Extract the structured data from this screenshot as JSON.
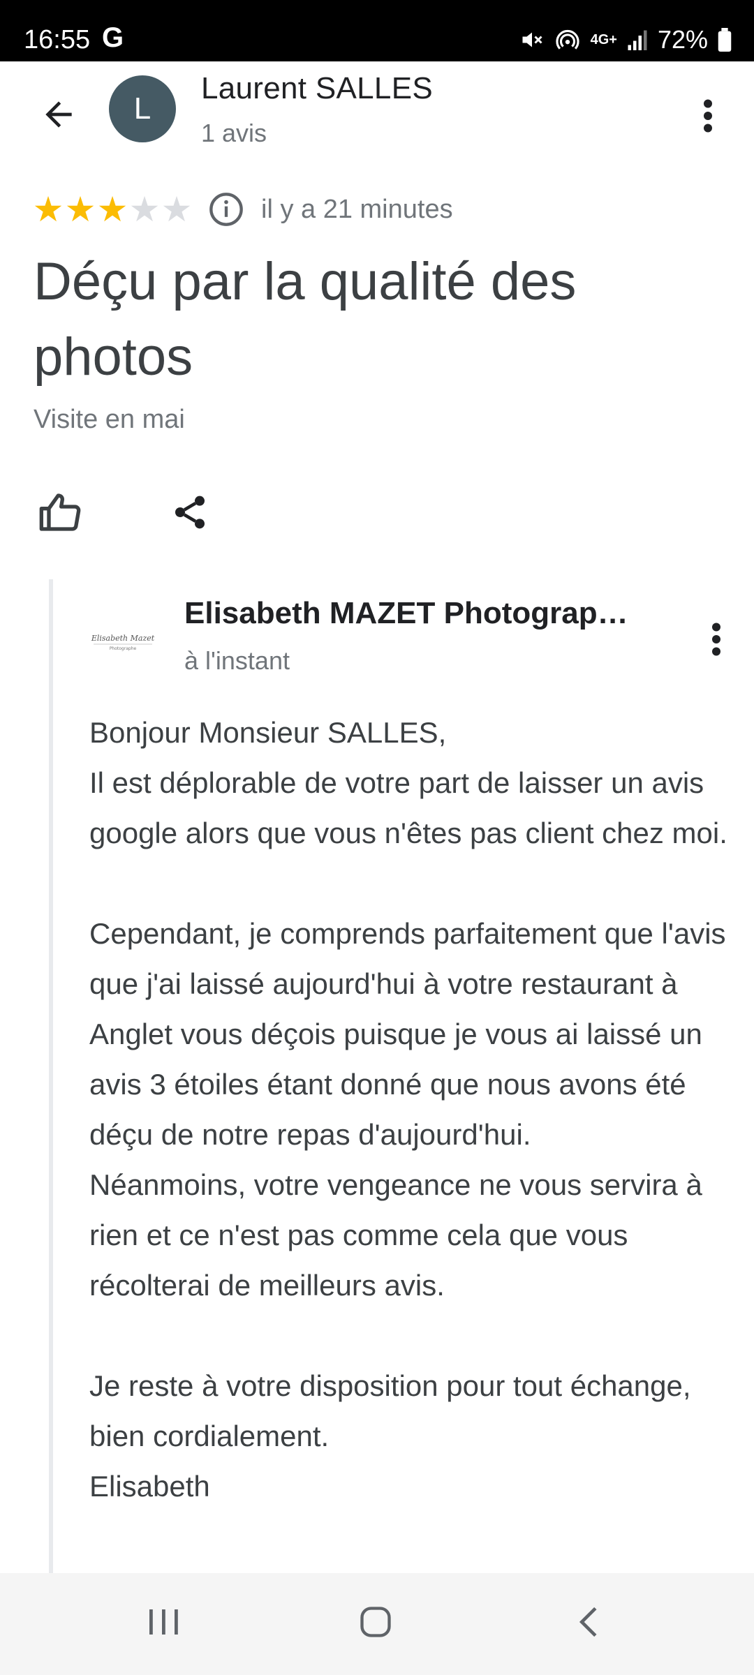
{
  "status_bar": {
    "time": "16:55",
    "g_label": "G",
    "battery": "72%",
    "network": "4G+"
  },
  "header": {
    "avatar_letter": "L",
    "author_name": "Laurent SALLES",
    "author_sub": "1 avis"
  },
  "review": {
    "rating": 3,
    "rating_max": 5,
    "time_ago": "il y a 21 minutes",
    "title": "Déçu par la qualité des photos",
    "visit": "Visite en mai"
  },
  "owner_reply": {
    "owner_name": "Elisabeth MAZET Photograp…",
    "time": "à l'instant",
    "logo_text": "Elisabeth Mazet",
    "logo_subtext": "Photographe",
    "paragraphs": [
      "Bonjour Monsieur SALLES,",
      "Il est déplorable de votre part de laisser un avis google alors que vous n'êtes pas client chez moi.",
      "",
      "Cependant, je comprends parfaitement que l'avis que j'ai laissé aujourd'hui à votre restaurant à Anglet vous déçois puisque je vous ai laissé un avis 3 étoiles étant donné que nous avons été déçu de notre repas d'aujourd'hui.",
      "Néanmoins, votre vengeance ne vous servira à rien et ce n'est pas comme cela que vous récolterai de meilleurs avis.",
      "",
      "Je reste à votre disposition pour tout échange, bien cordialement.",
      "Elisabeth"
    ]
  },
  "colors": {
    "star_on": "#fbbc04",
    "star_off": "#dadce0",
    "avatar_bg": "#455a64"
  }
}
